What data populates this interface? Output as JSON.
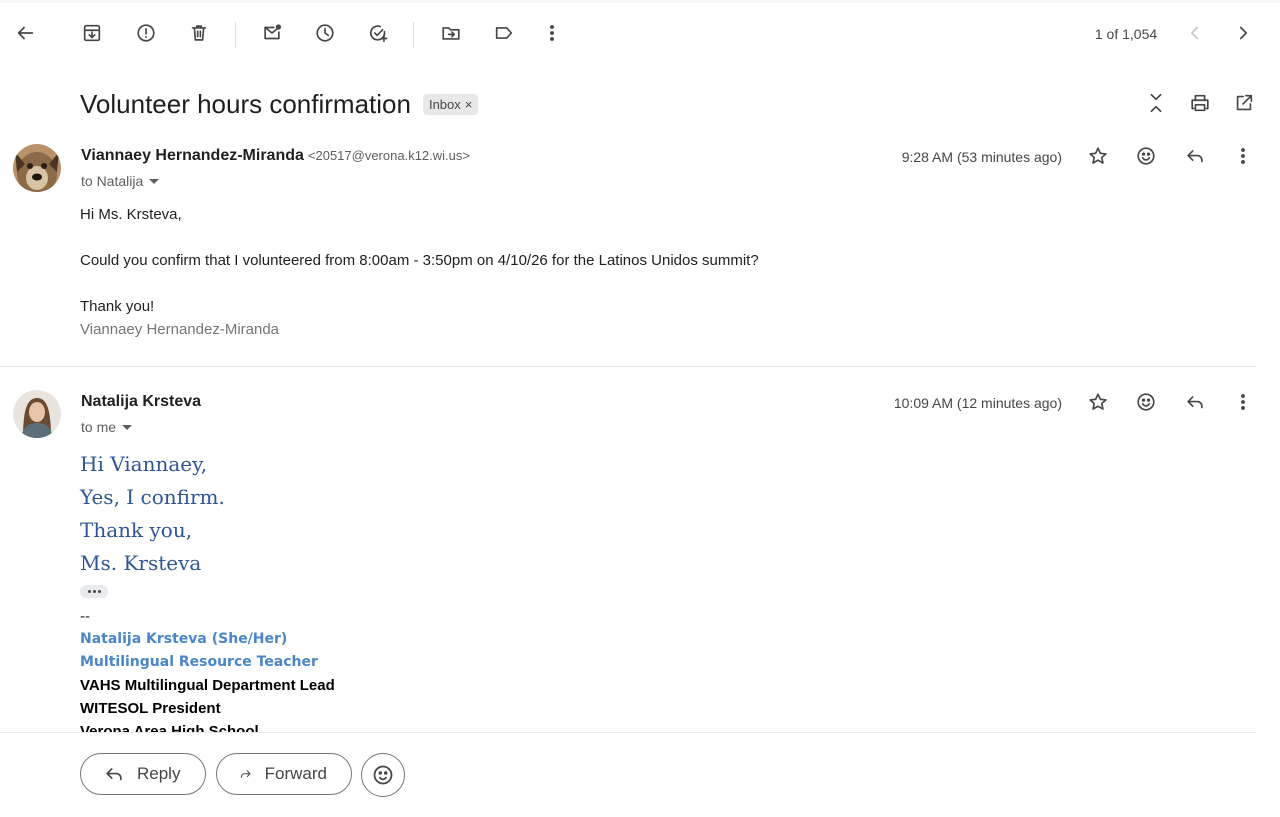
{
  "toolbar": {
    "page_count": "1 of 1,054"
  },
  "thread": {
    "subject": "Volunteer hours confirmation",
    "label": "Inbox",
    "label_remove": "×"
  },
  "messages": [
    {
      "sender_name": "Viannaey Hernandez-Miranda",
      "sender_email": "<20517@verona.k12.wi.us>",
      "to": "to Natalija",
      "time": "9:28 AM (53 minutes ago)",
      "body": {
        "greeting": "Hi Ms. Krsteva,",
        "text": "Could you confirm that I volunteered from 8:00am - 3:50pm on 4/10/26 for the Latinos Unidos summit?",
        "closing": "Thank you!",
        "signature": "Viannaey Hernandez-Miranda"
      }
    },
    {
      "sender_name": "Natalija Krsteva",
      "to": "to me",
      "time": "10:09 AM (12 minutes ago)",
      "body": {
        "line1": "Hi Viannaey,",
        "line2": "Yes, I confirm.",
        "line3": "Thank you,",
        "line4": "Ms. Krsteva"
      },
      "signature": {
        "dash": "--",
        "name": "Natalija Krsteva (She/Her)",
        "title": "Multilingual Resource Teacher",
        "role1": "VAHS Multilingual Department Lead",
        "role2": "WITESOL President",
        "school": "Verona Area High School"
      }
    }
  ],
  "actions": {
    "reply": "Reply",
    "forward": "Forward"
  }
}
